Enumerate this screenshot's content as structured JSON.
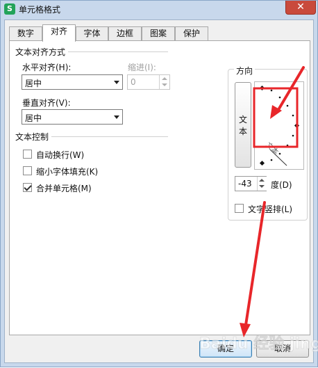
{
  "window": {
    "title": "单元格格式",
    "app_icon_glyph": "S",
    "close_glyph": "✕"
  },
  "tabs": [
    {
      "label": "数字",
      "active": false
    },
    {
      "label": "对齐",
      "active": true
    },
    {
      "label": "字体",
      "active": false
    },
    {
      "label": "边框",
      "active": false
    },
    {
      "label": "图案",
      "active": false
    },
    {
      "label": "保护",
      "active": false
    }
  ],
  "alignment": {
    "group_title": "文本对齐方式",
    "horizontal_label": "水平对齐(H):",
    "horizontal_value": "居中",
    "indent_label": "缩进(I):",
    "indent_value": "0",
    "vertical_label": "垂直对齐(V):",
    "vertical_value": "居中"
  },
  "text_control": {
    "group_title": "文本控制",
    "options": [
      {
        "label": "自动换行(W)",
        "checked": false
      },
      {
        "label": "缩小字体填充(K)",
        "checked": false
      },
      {
        "label": "合并单元格(M)",
        "checked": true
      }
    ]
  },
  "orientation": {
    "group_title": "方向",
    "vertical_text_label": [
      "文",
      "本"
    ],
    "dial_text": "文本",
    "degree_value": "-43",
    "degree_label": "度(D)",
    "vertical_text_checkbox": {
      "label": "文字竖排(L)",
      "checked": false
    }
  },
  "buttons": {
    "ok": "确定",
    "cancel": "取消"
  },
  "colors": {
    "annotation_red": "#e8262a",
    "title_bg": "#c8d8ec",
    "close_red": "#c94a3c"
  },
  "watermark": "Baidu 经验 jingyan.baidu.com"
}
